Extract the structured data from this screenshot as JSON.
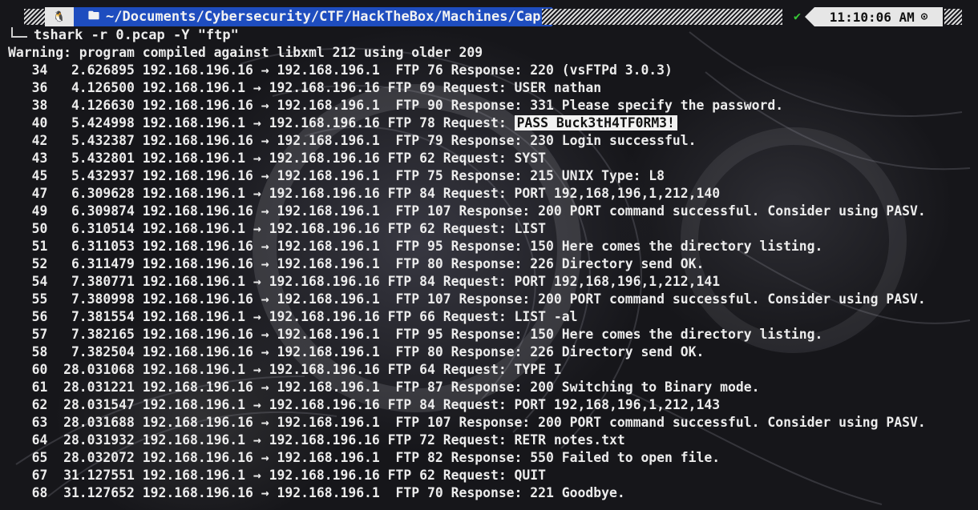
{
  "prompt": {
    "os_icon": "tux-icon",
    "folder_icon": "folder-icon",
    "path": "~/Documents/Cybersecurity/CTF/HackTheBox/Machines/Cap",
    "status_icon": "check-icon",
    "time": "11:10:06 AM",
    "clock_icon": "clock-icon"
  },
  "command": "tshark -r 0.pcap -Y \"ftp\"",
  "warning": "Warning: program compiled against libxml 212 using older 209",
  "packets": [
    {
      "no": "34",
      "time": "2.626895",
      "src": "192.168.196.16",
      "dst": "192.168.196.1",
      "proto": "FTP",
      "len": "76",
      "info": "Response: 220 (vsFTPd 3.0.3)"
    },
    {
      "no": "36",
      "time": "4.126500",
      "src": "192.168.196.1",
      "dst": "192.168.196.16",
      "proto": "FTP",
      "len": "69",
      "info": "Request: USER nathan"
    },
    {
      "no": "38",
      "time": "4.126630",
      "src": "192.168.196.16",
      "dst": "192.168.196.1",
      "proto": "FTP",
      "len": "90",
      "info": "Response: 331 Please specify the password."
    },
    {
      "no": "40",
      "time": "5.424998",
      "src": "192.168.196.1",
      "dst": "192.168.196.16",
      "proto": "FTP",
      "len": "78",
      "info": "Request:",
      "highlight": "PASS Buck3tH4TF0RM3!"
    },
    {
      "no": "42",
      "time": "5.432387",
      "src": "192.168.196.16",
      "dst": "192.168.196.1",
      "proto": "FTP",
      "len": "79",
      "info": "Response: 230 Login successful."
    },
    {
      "no": "43",
      "time": "5.432801",
      "src": "192.168.196.1",
      "dst": "192.168.196.16",
      "proto": "FTP",
      "len": "62",
      "info": "Request: SYST"
    },
    {
      "no": "45",
      "time": "5.432937",
      "src": "192.168.196.16",
      "dst": "192.168.196.1",
      "proto": "FTP",
      "len": "75",
      "info": "Response: 215 UNIX Type: L8"
    },
    {
      "no": "47",
      "time": "6.309628",
      "src": "192.168.196.1",
      "dst": "192.168.196.16",
      "proto": "FTP",
      "len": "84",
      "info": "Request: PORT 192,168,196,1,212,140"
    },
    {
      "no": "49",
      "time": "6.309874",
      "src": "192.168.196.16",
      "dst": "192.168.196.1",
      "proto": "FTP",
      "len": "107",
      "info": "Response: 200 PORT command successful. Consider using PASV."
    },
    {
      "no": "50",
      "time": "6.310514",
      "src": "192.168.196.1",
      "dst": "192.168.196.16",
      "proto": "FTP",
      "len": "62",
      "info": "Request: LIST"
    },
    {
      "no": "51",
      "time": "6.311053",
      "src": "192.168.196.16",
      "dst": "192.168.196.1",
      "proto": "FTP",
      "len": "95",
      "info": "Response: 150 Here comes the directory listing."
    },
    {
      "no": "52",
      "time": "6.311479",
      "src": "192.168.196.16",
      "dst": "192.168.196.1",
      "proto": "FTP",
      "len": "80",
      "info": "Response: 226 Directory send OK."
    },
    {
      "no": "54",
      "time": "7.380771",
      "src": "192.168.196.1",
      "dst": "192.168.196.16",
      "proto": "FTP",
      "len": "84",
      "info": "Request: PORT 192,168,196,1,212,141"
    },
    {
      "no": "55",
      "time": "7.380998",
      "src": "192.168.196.16",
      "dst": "192.168.196.1",
      "proto": "FTP",
      "len": "107",
      "info": "Response: 200 PORT command successful. Consider using PASV."
    },
    {
      "no": "56",
      "time": "7.381554",
      "src": "192.168.196.1",
      "dst": "192.168.196.16",
      "proto": "FTP",
      "len": "66",
      "info": "Request: LIST -al"
    },
    {
      "no": "57",
      "time": "7.382165",
      "src": "192.168.196.16",
      "dst": "192.168.196.1",
      "proto": "FTP",
      "len": "95",
      "info": "Response: 150 Here comes the directory listing."
    },
    {
      "no": "58",
      "time": "7.382504",
      "src": "192.168.196.16",
      "dst": "192.168.196.1",
      "proto": "FTP",
      "len": "80",
      "info": "Response: 226 Directory send OK."
    },
    {
      "no": "60",
      "time": "28.031068",
      "src": "192.168.196.1",
      "dst": "192.168.196.16",
      "proto": "FTP",
      "len": "64",
      "info": "Request: TYPE I"
    },
    {
      "no": "61",
      "time": "28.031221",
      "src": "192.168.196.16",
      "dst": "192.168.196.1",
      "proto": "FTP",
      "len": "87",
      "info": "Response: 200 Switching to Binary mode."
    },
    {
      "no": "62",
      "time": "28.031547",
      "src": "192.168.196.1",
      "dst": "192.168.196.16",
      "proto": "FTP",
      "len": "84",
      "info": "Request: PORT 192,168,196,1,212,143"
    },
    {
      "no": "63",
      "time": "28.031688",
      "src": "192.168.196.16",
      "dst": "192.168.196.1",
      "proto": "FTP",
      "len": "107",
      "info": "Response: 200 PORT command successful. Consider using PASV."
    },
    {
      "no": "64",
      "time": "28.031932",
      "src": "192.168.196.1",
      "dst": "192.168.196.16",
      "proto": "FTP",
      "len": "72",
      "info": "Request: RETR notes.txt"
    },
    {
      "no": "65",
      "time": "28.032072",
      "src": "192.168.196.16",
      "dst": "192.168.196.1",
      "proto": "FTP",
      "len": "82",
      "info": "Response: 550 Failed to open file."
    },
    {
      "no": "67",
      "time": "31.127551",
      "src": "192.168.196.1",
      "dst": "192.168.196.16",
      "proto": "FTP",
      "len": "62",
      "info": "Request: QUIT"
    },
    {
      "no": "68",
      "time": "31.127652",
      "src": "192.168.196.16",
      "dst": "192.168.196.1",
      "proto": "FTP",
      "len": "70",
      "info": "Response: 221 Goodbye."
    }
  ],
  "arrow": "→",
  "colors": {
    "background": "#16161a",
    "text": "#ececec",
    "path_segment": "#1e4dbf",
    "status_ok": "#37c837",
    "highlight_bg": "#f2f2f2"
  }
}
